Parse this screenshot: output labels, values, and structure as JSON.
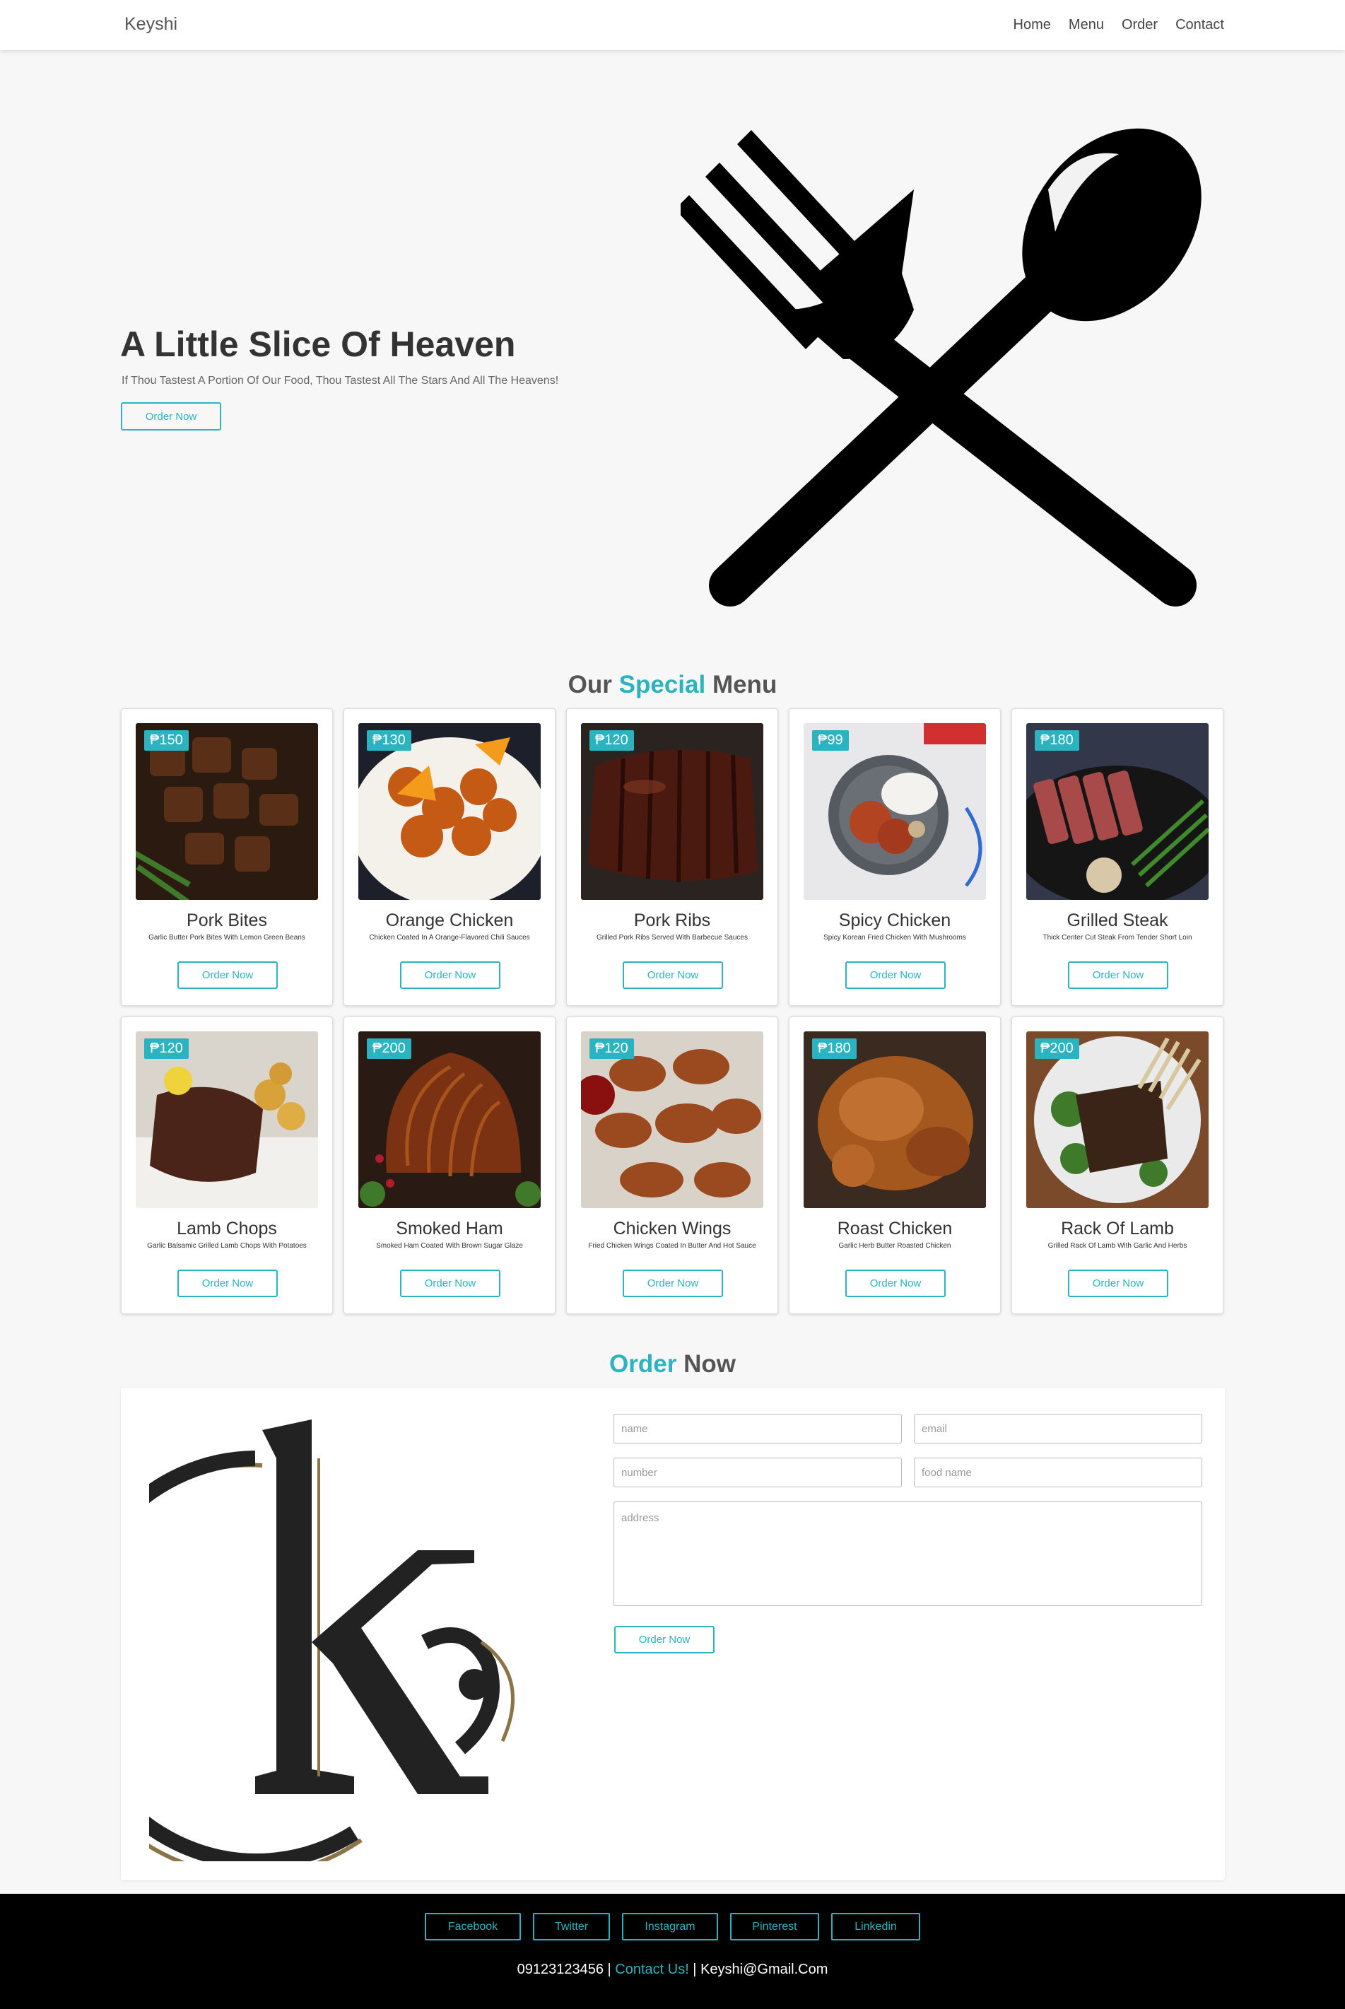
{
  "nav": {
    "brand": "Keyshi",
    "links": [
      "Home",
      "Menu",
      "Order",
      "Contact"
    ]
  },
  "hero": {
    "title": "A Little Slice Of Heaven",
    "subtitle": "If Thou Tastest A Portion Of Our Food, Thou Tastest All The Stars And All The Heavens!",
    "button": "Order Now"
  },
  "menu": {
    "title_pre": "Our",
    "title_accent": "Special",
    "title_post": "Menu",
    "items": [
      {
        "name": "Pork Bites",
        "price": "₱150",
        "desc": "Garlic Butter Pork Bites With Lemon Green Beans",
        "button": "Order Now"
      },
      {
        "name": "Orange Chicken",
        "price": "₱130",
        "desc": "Chicken Coated In A Orange-Flavored Chili Sauces",
        "button": "Order Now"
      },
      {
        "name": "Pork Ribs",
        "price": "₱120",
        "desc": "Grilled Pork Ribs Served With Barbecue Sauces",
        "button": "Order Now"
      },
      {
        "name": "Spicy Chicken",
        "price": "₱99",
        "desc": "Spicy Korean Fried Chicken With Mushrooms",
        "button": "Order Now"
      },
      {
        "name": "Grilled Steak",
        "price": "₱180",
        "desc": "Thick Center Cut Steak From Tender Short Loin",
        "button": "Order Now"
      },
      {
        "name": "Lamb Chops",
        "price": "₱120",
        "desc": "Garlic Balsamic Grilled Lamb Chops With Potatoes",
        "button": "Order Now"
      },
      {
        "name": "Smoked Ham",
        "price": "₱200",
        "desc": "Smoked Ham Coated With Brown Sugar Glaze",
        "button": "Order Now"
      },
      {
        "name": "Chicken Wings",
        "price": "₱120",
        "desc": "Fried Chicken Wings Coated In Butter And Hot Sauce",
        "button": "Order Now"
      },
      {
        "name": "Roast Chicken",
        "price": "₱180",
        "desc": "Garlic Herb Butter Roasted Chicken",
        "button": "Order Now"
      },
      {
        "name": "Rack Of Lamb",
        "price": "₱200",
        "desc": "Grilled Rack Of Lamb With Garlic And Herbs",
        "button": "Order Now"
      }
    ]
  },
  "order": {
    "title_accent": "Order",
    "title_post": "Now",
    "placeholders": {
      "name": "name",
      "email": "email",
      "number": "number",
      "food": "food name",
      "address": "address"
    },
    "button": "Order Now"
  },
  "footer": {
    "socials": [
      "Facebook",
      "Twitter",
      "Instagram",
      "Pinterest",
      "Linkedin"
    ],
    "phone": "09123123456",
    "sep1": " | ",
    "contact": "Contact Us!",
    "sep2": " | ",
    "email": "Keyshi@Gmail.Com"
  },
  "colors": {
    "accent": "#2bb3c0",
    "footer_bg": "#000000",
    "logo_gold": "#8b7448"
  }
}
